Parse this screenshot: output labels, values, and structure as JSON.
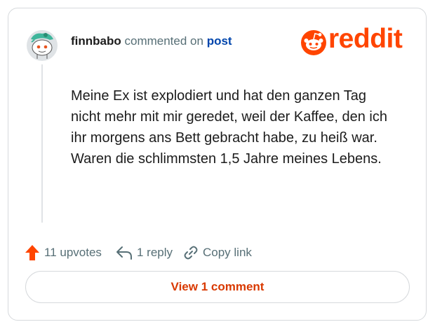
{
  "comment": {
    "username": "finnbabo",
    "action_text": "commented on",
    "post_link": "post",
    "body": "Meine Ex ist explodiert und hat den ganzen Tag nicht mehr mit mir geredet, weil der Kaffee, den ich ihr morgens ans Bett gebracht habe, zu heiß war. Waren die schlimmsten 1,5 Jahre meines Lebens."
  },
  "brand": {
    "name": "reddit",
    "color": "#ff4500"
  },
  "actions": {
    "upvotes": "11 upvotes",
    "replies": "1 reply",
    "copy_link": "Copy link"
  },
  "view_button": "View 1 comment",
  "icons": [
    "snoo-avatar-icon",
    "reddit-logo-icon",
    "upvote-arrow-icon",
    "reply-arrow-icon",
    "link-icon"
  ]
}
